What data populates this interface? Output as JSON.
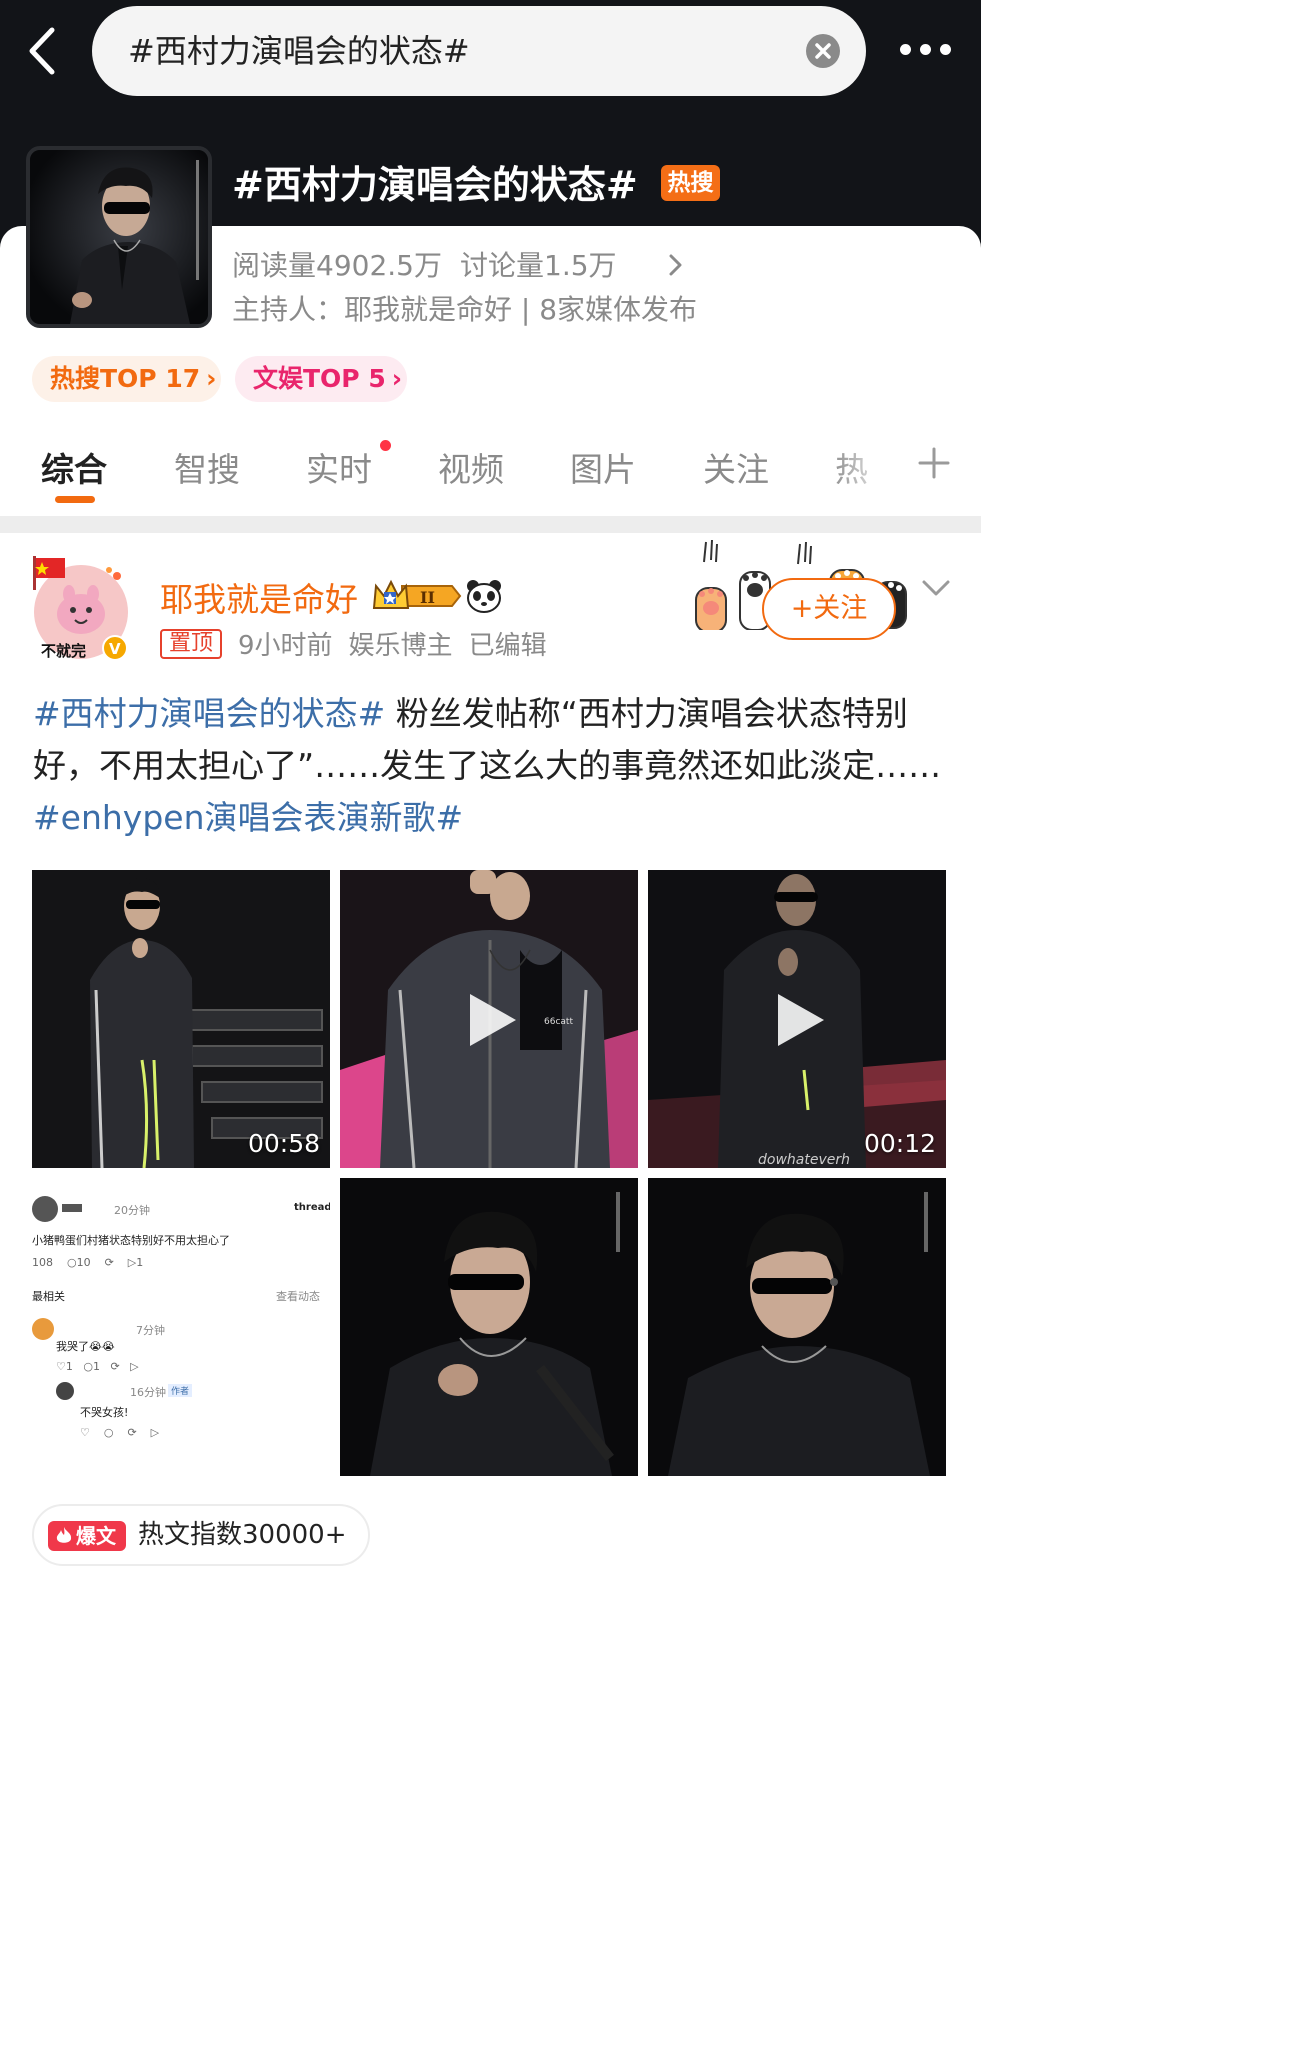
{
  "search": {
    "query": "#西村力演唱会的状态#"
  },
  "topic": {
    "title": "#西村力演唱会的状态#",
    "hot_badge": "热搜",
    "reads_label": "阅读量",
    "reads_value": "4902.5万",
    "discussion_label": "讨论量",
    "discussion_value": "1.5万",
    "host_line": "主持人：耶我就是命好 | 8家媒体发布"
  },
  "rank_chips": [
    {
      "label": "热搜TOP 17"
    },
    {
      "label": "文娱TOP 5"
    }
  ],
  "tabs": [
    {
      "label": "综合",
      "active": true
    },
    {
      "label": "智搜"
    },
    {
      "label": "实时",
      "has_dot": true
    },
    {
      "label": "视频"
    },
    {
      "label": "图片"
    },
    {
      "label": "关注"
    },
    {
      "label": "热"
    }
  ],
  "post": {
    "author": "耶我就是命好",
    "pinned_tag": "置顶",
    "time": "9小时前",
    "author_type": "娱乐博主",
    "edited": "已编辑",
    "follow_label": "+关注",
    "avatar_text": "不就完",
    "text_hashtag_1": "#西村力演唱会的状态#",
    "text_body": " 粉丝发帖称“西村力演唱会状态特别好，不用太担心了”……发生了这么大的事竟然还如此淡定……",
    "text_hashtag_2": "#enhypen演唱会表演新歌#",
    "media": [
      {
        "type": "video",
        "duration": "00:58"
      },
      {
        "type": "video"
      },
      {
        "type": "video",
        "duration": "00:12",
        "watermark": "dowhateverh"
      },
      {
        "type": "screenshot"
      },
      {
        "type": "image"
      },
      {
        "type": "image"
      }
    ],
    "screenshot": {
      "time1": "20分钟",
      "app": "threads",
      "line1": "小猪鸭蛋们村猪状态特别好不用太担心了",
      "counts1": [
        "108",
        "10",
        "1"
      ],
      "filter": "最相关",
      "view_more": "查看动态",
      "time2": "7分钟",
      "reply1": "我哭了😭😭",
      "counts2": [
        "1",
        "1"
      ],
      "time3": "16分钟",
      "author_tag": "作者",
      "reply2": "不哭女孩!"
    },
    "hot_index_tag": "爆文",
    "hot_index_text": "热文指数30000+"
  },
  "colors": {
    "header_bg": "#121418",
    "accent_orange": "#f26a10",
    "accent_pink": "#e9256c",
    "hashtag_blue": "#3c6ea8",
    "hot_badge": "#f46e16",
    "burst_red": "#f0384a"
  },
  "icons": [
    "back-arrow-icon",
    "clear-icon",
    "more-dots-icon",
    "chevron-right-icon",
    "plus-icon",
    "crown-badge-icon",
    "panda-icon",
    "paw-icon",
    "chevron-down-icon",
    "play-icon",
    "burst-icon"
  ]
}
